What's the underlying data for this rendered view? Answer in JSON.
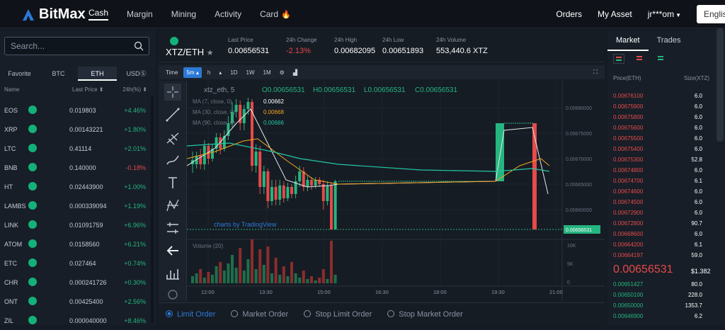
{
  "brand": {
    "name": "BitMax",
    "accent": "#2c79d6"
  },
  "nav": {
    "cash": "Cash",
    "margin": "Margin",
    "mining": "Mining",
    "activity": "Activity",
    "card": "Card"
  },
  "nav_right": {
    "orders": "Orders",
    "my_asset": "My Asset",
    "user": "jr***om",
    "lang": "English"
  },
  "search": {
    "placeholder": "Search..."
  },
  "market_tabs": [
    "Favorite",
    "BTC",
    "ETH",
    "USDⓈ"
  ],
  "market_tab_active": "ETH",
  "market_headers": {
    "name": "Name",
    "last_price": "Last Price ⬍",
    "change": "24h(%) ⬍"
  },
  "markets": [
    {
      "coin": "EOS",
      "price": "0.019803",
      "change": "+4.46%",
      "dir": "up"
    },
    {
      "coin": "XRP",
      "price": "0.00143221",
      "change": "+1.80%",
      "dir": "up"
    },
    {
      "coin": "LTC",
      "price": "0.41114",
      "change": "+2.01%",
      "dir": "up"
    },
    {
      "coin": "BNB",
      "price": "0.140000",
      "change": "-0.18%",
      "dir": "down"
    },
    {
      "coin": "HT",
      "price": "0.02443900",
      "change": "+1.00%",
      "dir": "up"
    },
    {
      "coin": "LAMBS",
      "price": "0.000339094",
      "change": "+1.19%",
      "dir": "up"
    },
    {
      "coin": "LINK",
      "price": "0.01091759",
      "change": "+6.96%",
      "dir": "up"
    },
    {
      "coin": "ATOM",
      "price": "0.0158560",
      "change": "+6.21%",
      "dir": "up"
    },
    {
      "coin": "ETC",
      "price": "0.027464",
      "change": "+0.74%",
      "dir": "up"
    },
    {
      "coin": "CHR",
      "price": "0.000241726",
      "change": "+0.30%",
      "dir": "up"
    },
    {
      "coin": "ONT",
      "price": "0.00425400",
      "change": "+2.56%",
      "dir": "up"
    },
    {
      "coin": "ZIL",
      "price": "0.000040000",
      "change": "+8.46%",
      "dir": "up"
    }
  ],
  "pair": {
    "name": "XTZ/ETH",
    "last_price_label": "Last Price",
    "last_price": "0.00656531",
    "change_label": "24h Change",
    "change": "-2.13%",
    "high_label": "24h High",
    "high": "0.00682095",
    "low_label": "24h Low",
    "low": "0.00651893",
    "volume_label": "24h Volume",
    "volume": "553,440.6 XTZ"
  },
  "timeframes": [
    "Time",
    "5m ▴",
    "h",
    "▴",
    "1D",
    "1W",
    "1M"
  ],
  "timeframe_active": "5m ▴",
  "chart_legend": {
    "symbol": "xtz_eth, 5",
    "ohlc": [
      {
        "k": "O",
        "v": "0.00656531"
      },
      {
        "k": "H",
        "v": "0.00656531"
      },
      {
        "k": "L",
        "v": "0.00656531"
      },
      {
        "k": "C",
        "v": "0.00656531"
      }
    ],
    "ma": [
      {
        "label": "MA (7, close, 0)",
        "value": "0.00662",
        "color": "#ffffff"
      },
      {
        "label": "MA (30, close, 0)",
        "value": "0.00668",
        "color": "#f5a623"
      },
      {
        "label": "MA (90, close, 0)",
        "value": "0.00666",
        "color": "#24c6a5"
      }
    ],
    "watermark": "charts by TradingView",
    "volume_label": "Volume (20)"
  },
  "chart_data": {
    "type": "candlestick",
    "x_ticks": [
      "12:00",
      "13:30",
      "15:00",
      "16:30",
      "18:00",
      "19:30",
      "21:00"
    ],
    "price_ticks": [
      "0.00680000",
      "0.00675000",
      "0.00670000",
      "0.00665000",
      "0.00660000"
    ],
    "current_price_label": "0.00656531",
    "volume_ticks": [
      "10K",
      "5K",
      "0"
    ]
  },
  "order_types": [
    "Limit Order",
    "Market Order",
    "Stop Limit Order",
    "Stop Market Order"
  ],
  "order_type_active": "Limit Order",
  "book_tabs": [
    "Market",
    "Trades"
  ],
  "book_headers": {
    "price": "Price(ETH)",
    "size": "Size(XTZ)"
  },
  "asks": [
    {
      "p": "0.00676100",
      "s": "6.0"
    },
    {
      "p": "0.00675900",
      "s": "6.0"
    },
    {
      "p": "0.00675800",
      "s": "6.0"
    },
    {
      "p": "0.00675600",
      "s": "6.0"
    },
    {
      "p": "0.00675500",
      "s": "6.0"
    },
    {
      "p": "0.00675400",
      "s": "6.0"
    },
    {
      "p": "0.00675300",
      "s": "52.8"
    },
    {
      "p": "0.00674800",
      "s": "6.0"
    },
    {
      "p": "0.00674700",
      "s": "6.1"
    },
    {
      "p": "0.00674600",
      "s": "6.0"
    },
    {
      "p": "0.00674500",
      "s": "6.0"
    },
    {
      "p": "0.00672900",
      "s": "6.0"
    },
    {
      "p": "0.00672800",
      "s": "90.7"
    },
    {
      "p": "0.00668600",
      "s": "6.0"
    },
    {
      "p": "0.00664200",
      "s": "6.1"
    },
    {
      "p": "0.00664197",
      "s": "59.0"
    }
  ],
  "last_trade": {
    "price": "0.00656531",
    "fiat": "$1.382"
  },
  "bids": [
    {
      "p": "0.00651427",
      "s": "80.0"
    },
    {
      "p": "0.00650100",
      "s": "228.0"
    },
    {
      "p": "0.00650000",
      "s": "1353.7"
    },
    {
      "p": "0.00646900",
      "s": "6.2"
    }
  ]
}
